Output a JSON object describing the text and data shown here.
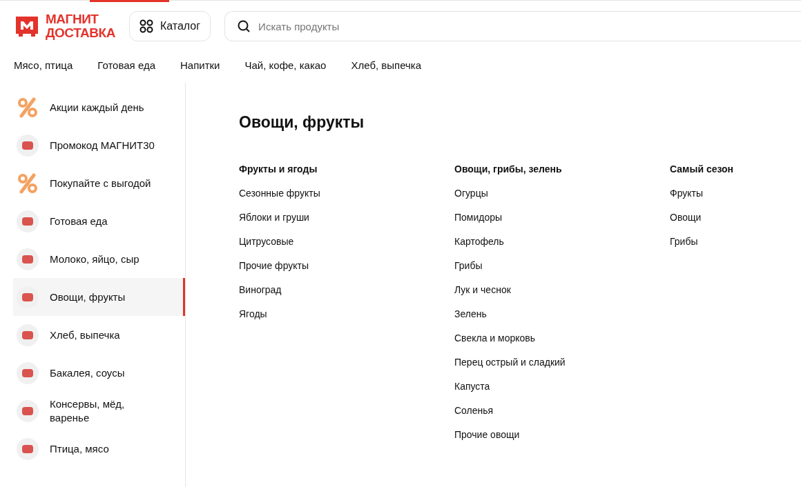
{
  "logo": {
    "line_1": "МАГНИТ",
    "line_2": "ДОСТАВКА"
  },
  "catalog_button": {
    "label": "Каталог"
  },
  "search": {
    "placeholder": "Искать продукты"
  },
  "nav": [
    "Мясо, птица",
    "Готовая еда",
    "Напитки",
    "Чай, кофе, какао",
    "Хлеб, выпечка"
  ],
  "sidebar": {
    "items": [
      {
        "label": "Акции каждый день",
        "kind": "percent",
        "selected": false
      },
      {
        "label": "Промокод МАГНИТ30",
        "kind": "photo",
        "selected": false
      },
      {
        "label": "Покупайте с выгодой",
        "kind": "percent",
        "selected": false
      },
      {
        "label": "Готовая еда",
        "kind": "photo",
        "selected": false
      },
      {
        "label": "Молоко, яйцо, сыр",
        "kind": "photo",
        "selected": false
      },
      {
        "label": "Овощи, фрукты",
        "kind": "photo",
        "selected": true
      },
      {
        "label": "Хлеб, выпечка",
        "kind": "photo",
        "selected": false
      },
      {
        "label": "Бакалея, соусы",
        "kind": "photo",
        "selected": false
      },
      {
        "label": "Консервы, мёд, варенье",
        "kind": "photo",
        "selected": false
      },
      {
        "label": "Птица, мясо",
        "kind": "photo",
        "selected": false
      }
    ]
  },
  "content": {
    "title": "Овощи, фрукты",
    "groups": [
      {
        "heading": "Фрукты и ягоды",
        "links": [
          "Сезонные фрукты",
          "Яблоки и груши",
          "Цитрусовые",
          "Прочие фрукты",
          "Виноград",
          "Ягоды"
        ]
      },
      {
        "heading": "Овощи, грибы, зелень",
        "links": [
          "Огурцы",
          "Помидоры",
          "Картофель",
          "Грибы",
          "Лук и чеснок",
          "Зелень",
          "Свекла и морковь",
          "Перец острый и сладкий",
          "Капуста",
          "Соленья",
          "Прочие овощи"
        ]
      },
      {
        "heading": "Самый сезон",
        "links": [
          "Фрукты",
          "Овощи",
          "Грибы"
        ]
      }
    ]
  }
}
